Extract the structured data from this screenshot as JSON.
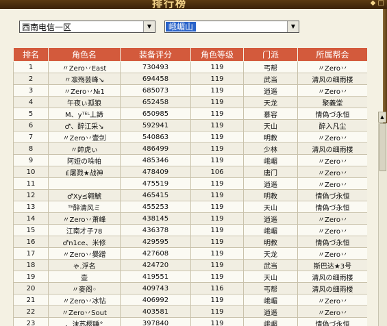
{
  "window": {
    "title": "排行榜",
    "close_glyph": "◆ □"
  },
  "filters": {
    "region": "西南电信一区",
    "server": "峨嵋山"
  },
  "table": {
    "headers": [
      "排名",
      "角色名",
      "装备评分",
      "角色等级",
      "门派",
      "所属帮会"
    ],
    "rows": [
      [
        "1",
        "〃Zero丷East",
        "730493",
        "119",
        "丐帮",
        "〃Zero丷"
      ],
      [
        "2",
        "〃凛殇芸峰↘",
        "694458",
        "119",
        "武当",
        "清风の细雨楼"
      ],
      [
        "3",
        "〃Zero丷№1",
        "685073",
        "119",
        "逍遥",
        "〃Zero丷"
      ],
      [
        "4",
        "午夜ぃ孤狼",
        "652458",
        "119",
        "天龙",
        "聚義堂"
      ],
      [
        "5",
        "M、yᵀᴱᴸ丄諦",
        "650985",
        "119",
        "慕容",
        "情偽づ永恒"
      ],
      [
        "6",
        "♂、醉江采↘",
        "592941",
        "119",
        "天山",
        "醉入凡尘"
      ],
      [
        "7",
        "〃Zero丷壹剑",
        "540863",
        "119",
        "明教",
        "〃Zero丷"
      ],
      [
        "8",
        "〃帥虎ぃ",
        "486499",
        "119",
        "少林",
        "清风の细雨楼"
      ],
      [
        "9",
        "阿娅の哚帕",
        "485346",
        "119",
        "峨嵋",
        "〃Zero丷"
      ],
      [
        "10",
        "£屠戮★战神",
        "478409",
        "106",
        "唐门",
        "〃Zero丷"
      ],
      [
        "11",
        "",
        "475519",
        "119",
        "逍遥",
        "〃Zero丷"
      ],
      [
        "12",
        "♂Xy≤翱鯱",
        "465415",
        "119",
        "明教",
        "情偽づ永恒"
      ],
      [
        "13",
        "ᵀᴱ醉清风ミ",
        "455253",
        "119",
        "天山",
        "情偽づ永恒"
      ],
      [
        "14",
        "〃Zero丷萧峰",
        "438145",
        "119",
        "逍遥",
        "〃Zero丷"
      ],
      [
        "15",
        "江南才子78",
        "436378",
        "119",
        "峨嵋",
        "〃Zero丷"
      ],
      [
        "16",
        "♂n1ce、米修",
        "429595",
        "119",
        "明教",
        "情偽づ永恒"
      ],
      [
        "17",
        "〃Zero丷爨蹭",
        "427608",
        "119",
        "天龙",
        "〃Zero丷"
      ],
      [
        "18",
        "ゃ.浮名",
        "424720",
        "119",
        "武当",
        "斯巴达★3号"
      ],
      [
        "19",
        "壶",
        "419551",
        "119",
        "天山",
        "清风の细雨楼"
      ],
      [
        "20",
        "〃麥阁◦",
        "409743",
        "116",
        "丐帮",
        "清风の细雨楼"
      ],
      [
        "21",
        "〃Zero丷冰钻",
        "406992",
        "119",
        "峨嵋",
        "〃Zero丷"
      ],
      [
        "22",
        "〃Zero丷Sout",
        "403581",
        "119",
        "逍遥",
        "〃Zero丷"
      ],
      [
        "23",
        "、沫苏樱睡°",
        "397840",
        "119",
        "峨嵋",
        "情偽づ永恒"
      ]
    ]
  },
  "colors": {
    "header_bg": "#d35a3c",
    "frame": "#5a3a12",
    "selection": "#2a63c9"
  }
}
